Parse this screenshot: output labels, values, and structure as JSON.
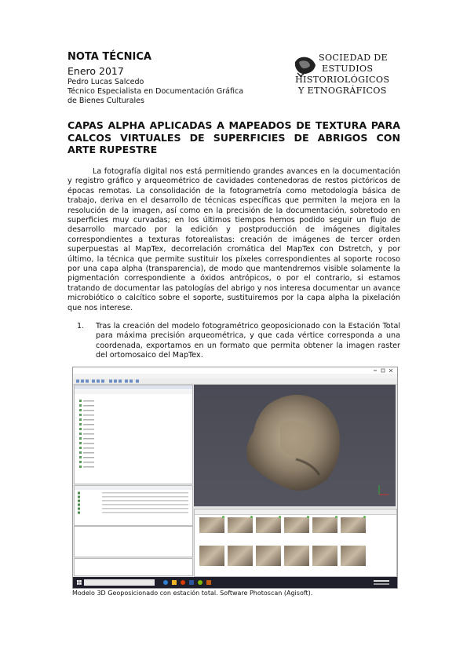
{
  "header": {
    "note_title": "NOTA TÉCNICA",
    "date": "Enero 2017",
    "author": "Pedro Lucas Salcedo",
    "role_line1": "Técnico Especialista en Documentación Gráfica",
    "role_line2": "de Bienes Culturales"
  },
  "logo": {
    "line1": "SOCIEDAD DE",
    "line2": "ESTUDIOS",
    "line3": "HISTORIOLÓGICOS",
    "line4": "Y ETNOGRÁFICOS"
  },
  "article": {
    "title": "CAPAS ALPHA APLICADAS A MAPEADOS DE TEXTURA PARA CALCOS VIRTUALES DE SUPERFICIES DE ABRIGOS CON ARTE RUPESTRE",
    "paragraph": "La fotografía digital nos está permitiendo grandes avances en la documentación y registro gráfico y arqueométrico de cavidades contenedoras de restos pictóricos de épocas remotas. La consolidación de la fotogrametría como metodología básica de trabajo, deriva en el desarrollo de técnicas específicas que permiten la mejora en la resolución de la imagen, así como en la precisión de la documentación, sobretodo en superficies muy curvadas; en los últimos tiempos hemos podido seguir un flujo de desarrollo marcado por la edición y postproducción de imágenes digitales correspondientes a texturas fotorealistas: creación de imágenes de tercer orden superpuestas al MapTex, decorrelación cromática del MapTex con Dstretch, y por último, la técnica que permite sustituir los píxeles correspondientes al soporte rocoso por una capa alpha (transparencia), de modo que mantendremos visible solamente la pigmentación correspondiente a óxidos antrópicos, o por el contrario, si estamos tratando de documentar las patologías del abrigo y nos interesa documentar un avance microbiótico o calcítico sobre el soporte, sustituiremos por la capa alpha la pixelación que nos interese.",
    "list_items": [
      {
        "number": "1.",
        "text": "Tras la creación del modelo fotogramétrico geoposicionado con la Estación Total para máxima precisión arqueométrica, y que cada vértice corresponda a una coordenada, exportamos en un formato que permita obtener la imagen raster del ortomosaico del MapTex."
      }
    ],
    "figure_caption": "Modelo 3D Geoposicionado con estación total. Software Photoscan (Agisoft)."
  },
  "colors": {
    "text": "#111111",
    "viewport": "#4f4f5a",
    "taskbar": "#1f1f2b"
  }
}
